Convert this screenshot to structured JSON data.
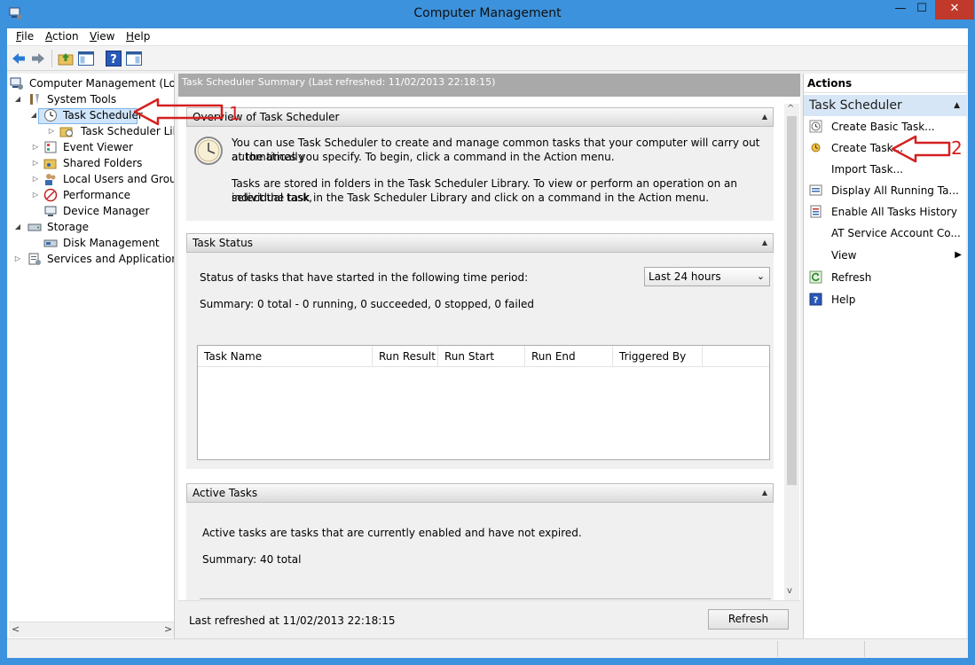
{
  "window": {
    "title": "Computer Management",
    "minimize": "—",
    "maximize": "☐",
    "close": "✕"
  },
  "menu": [
    "File",
    "Action",
    "View",
    "Help"
  ],
  "tree": {
    "root": "Computer Management (Local",
    "system_tools": "System Tools",
    "task_scheduler": "Task Scheduler",
    "task_scheduler_library": "Task Scheduler Libra",
    "event_viewer": "Event Viewer",
    "shared_folders": "Shared Folders",
    "local_users": "Local Users and Groups",
    "performance": "Performance",
    "device_manager": "Device Manager",
    "storage": "Storage",
    "disk_management": "Disk Management",
    "services": "Services and Applications"
  },
  "center": {
    "header": "Task Scheduler Summary (Last refreshed: 11/02/2013 22:18:15)",
    "overview": {
      "title": "Overview of Task Scheduler",
      "p1a": "You can use Task Scheduler to create and manage common tasks that your computer will carry out automatically",
      "p1b": "at the times you specify. To begin, click a command in the Action menu.",
      "p2a": "Tasks are stored in folders in the Task Scheduler Library. To view or perform an operation on an individual task,",
      "p2b": "select the task in the Task Scheduler Library and click on a command in the Action menu."
    },
    "task_status": {
      "title": "Task Status",
      "period_label": "Status of tasks that have started in the following time period:",
      "period_value": "Last 24 hours",
      "summary": "Summary: 0 total - 0 running, 0 succeeded, 0 stopped, 0 failed",
      "columns": [
        "Task Name",
        "Run Result",
        "Run Start",
        "Run End",
        "Triggered By"
      ]
    },
    "active_tasks": {
      "title": "Active Tasks",
      "description": "Active tasks are tasks that are currently enabled and have not expired.",
      "summary": "Summary: 40 total"
    },
    "footer": {
      "last_refreshed": "Last refreshed at 11/02/2013 22:18:15",
      "refresh_button": "Refresh"
    }
  },
  "actions": {
    "header": "Actions",
    "group": "Task Scheduler",
    "items": [
      "Create Basic Task...",
      "Create Task...",
      "Import Task...",
      "Display All Running Ta...",
      "Enable All Tasks History",
      "AT Service Account Co...",
      "View",
      "Refresh",
      "Help"
    ]
  },
  "annotations": {
    "first": "1",
    "second": "2"
  },
  "colors": {
    "titlebar": "#3c92dc",
    "annotation": "#d42020",
    "selection": "#cfe5fb",
    "actions_group": "#d7e6f6"
  }
}
